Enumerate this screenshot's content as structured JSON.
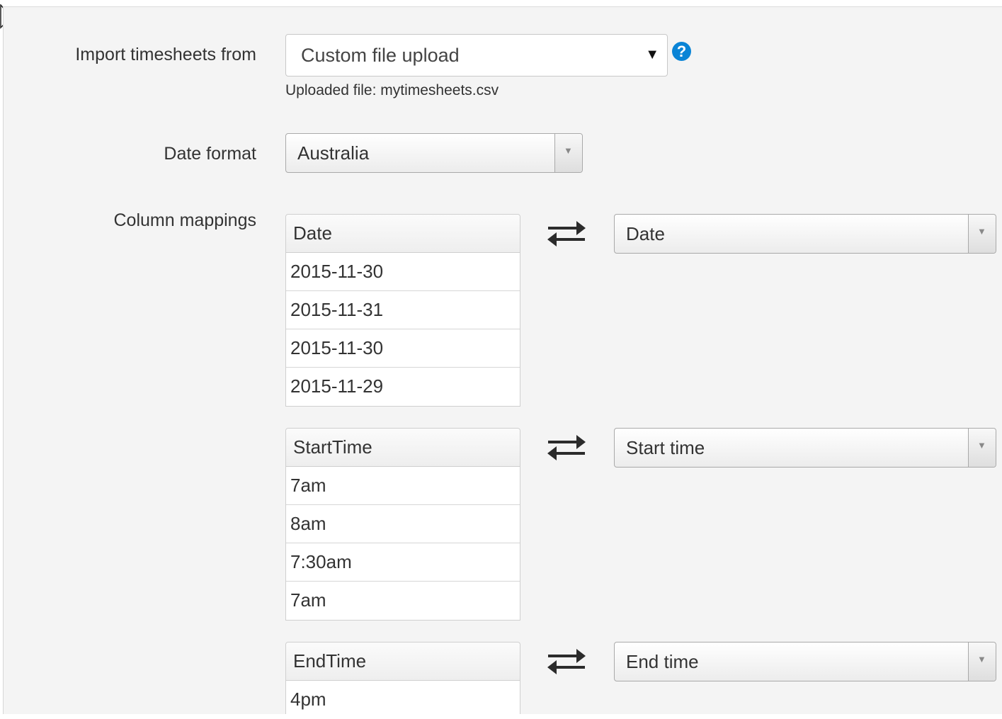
{
  "import": {
    "label": "Import timesheets from",
    "selected": "Custom file upload",
    "uploaded_text": "Uploaded file: mytimesheets.csv"
  },
  "date_format": {
    "label": "Date format",
    "selected": "Australia"
  },
  "column_mappings": {
    "label": "Column mappings",
    "mappings": [
      {
        "column": "Date",
        "values": [
          "2015-11-30",
          "2015-11-31",
          "2015-11-30",
          "2015-11-29"
        ],
        "target": "Date"
      },
      {
        "column": "StartTime",
        "values": [
          "7am",
          "8am",
          "7:30am",
          "7am"
        ],
        "target": "Start time"
      },
      {
        "column": "EndTime",
        "values": [
          "4pm"
        ],
        "target": "End time"
      }
    ]
  }
}
